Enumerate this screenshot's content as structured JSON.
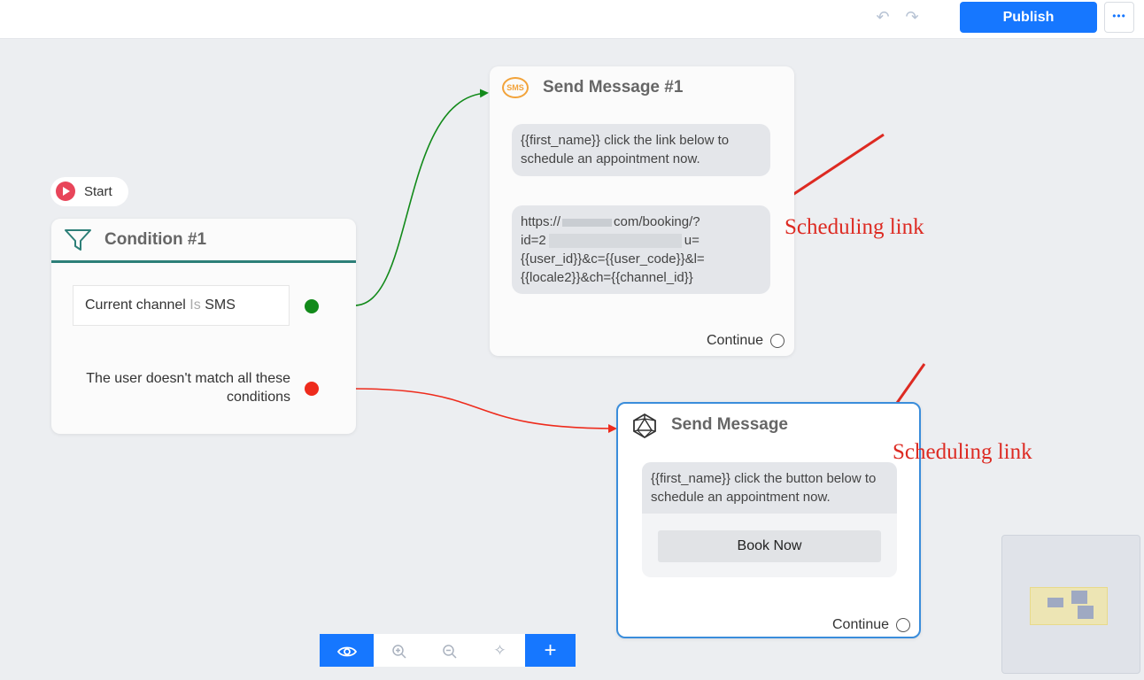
{
  "toolbar": {
    "undo_icon": "undo-icon",
    "redo_icon": "redo-icon",
    "publish_label": "Publish",
    "more_label": "•••"
  },
  "start": {
    "label": "Start"
  },
  "condition_node": {
    "title": "Condition #1",
    "rule_field": "Current channel",
    "rule_operator": "Is",
    "rule_value": "SMS",
    "else_label": "The user doesn't match all these conditions"
  },
  "sms_node": {
    "title": "Send Message #1",
    "icon_text": "SMS",
    "message_text": "{{first_name}} click the link below to schedule an appointment now.",
    "link_line1_start": "https://",
    "link_line1_end": "com/booking/?",
    "link_line2_start": "id=2",
    "link_line2_end": "u=",
    "link_line3": "{{user_id}}&c={{user_code}}&l=",
    "link_line4": "{{locale2}}&ch={{channel_id}}",
    "continue_label": "Continue"
  },
  "button_node": {
    "title": "Send Message",
    "message_text": "{{first_name}} click the button below to schedule an appointment now.",
    "button_label": "Book Now",
    "continue_label": "Continue"
  },
  "annotations": {
    "label1": "Scheduling link",
    "label2": "Scheduling link",
    "arrow_color": "#dd2a22"
  },
  "canvas_toolbar": {
    "eye_icon": "eye-icon",
    "zoom_in_icon": "zoom-in-icon",
    "zoom_out_icon": "zoom-out-icon",
    "auto_layout_icon": "magic-wand-icon",
    "add_label": "+"
  },
  "colors": {
    "accent": "#1677ff",
    "condition_match": "#128a1a",
    "condition_else": "#ee2b1c",
    "sms_icon": "#f2a33a",
    "selected_border": "#3a8ddb"
  }
}
